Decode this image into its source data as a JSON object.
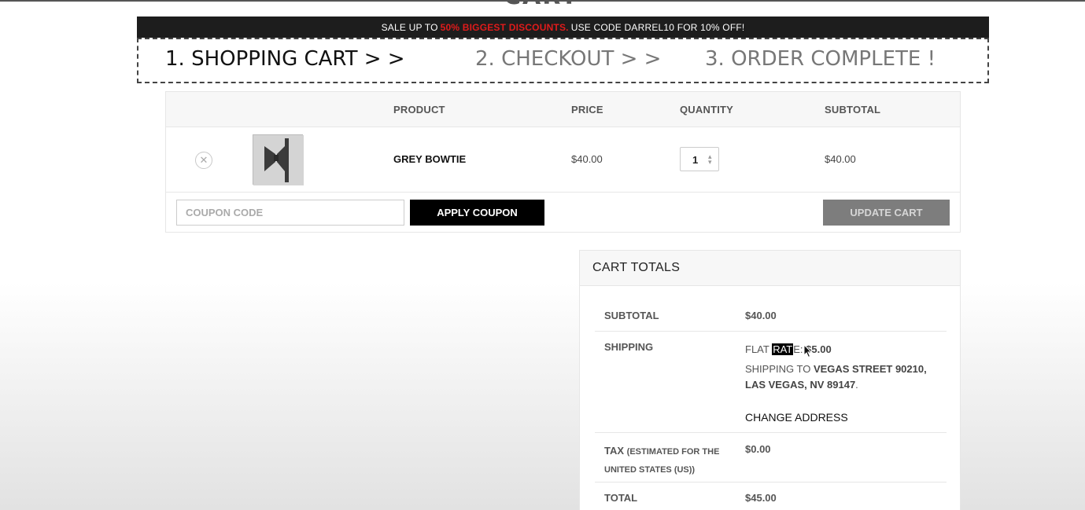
{
  "page": {
    "title_fragment": "CART"
  },
  "sale_banner": {
    "prefix": "SALE UP TO",
    "highlight": "50% BIGGEST DISCOUNTS.",
    "suffix": "USE CODE DARREL10 FOR 10% OFF!",
    "highlight_color": "#e01b1b"
  },
  "steps": [
    {
      "label": "1. SHOPPING CART > >",
      "active": true
    },
    {
      "label": "2. CHECKOUT > >",
      "active": false
    },
    {
      "label": "3. ORDER COMPLETE !",
      "active": false
    }
  ],
  "cart": {
    "headers": {
      "product": "PRODUCT",
      "price": "PRICE",
      "quantity": "QUANTITY",
      "subtotal": "SUBTOTAL"
    },
    "items": [
      {
        "remove_icon": "close-icon",
        "name": "GREY BOWTIE",
        "price": "$40.00",
        "quantity": "1",
        "subtotal": "$40.00"
      }
    ],
    "coupon_placeholder": "COUPON CODE",
    "apply_label": "APPLY COUPON",
    "update_label": "UPDATE CART"
  },
  "totals": {
    "heading": "CART TOTALS",
    "subtotal_label": "SUBTOTAL",
    "subtotal_value": "$40.00",
    "shipping_label": "SHIPPING",
    "shipping_method_prefix": "FLAT ",
    "shipping_method_highlight": "RAT",
    "shipping_method_suffix": "E: ",
    "shipping_cost": "$5.00",
    "shipping_to_prefix": "SHIPPING TO ",
    "shipping_address_line1": "VEGAS STREET 90210,",
    "shipping_address_line2": "LAS VEGAS, NV 89147",
    "shipping_address_end": ".",
    "change_address": "CHANGE ADDRESS",
    "tax_label": "TAX",
    "tax_note_line1": "(ESTIMATED FOR THE",
    "tax_note_line2": "UNITED STATES (US))",
    "tax_value": "$0.00",
    "total_label": "TOTAL",
    "total_value": "$45.00"
  }
}
